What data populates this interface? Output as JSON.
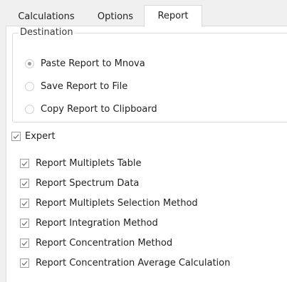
{
  "tabs": [
    {
      "label": "Calculations",
      "active": false
    },
    {
      "label": "Options",
      "active": false
    },
    {
      "label": "Report",
      "active": true
    }
  ],
  "destination": {
    "title": "Destination",
    "options": [
      {
        "label": "Paste Report to Mnova",
        "selected": true
      },
      {
        "label": "Save Report to File",
        "selected": false
      },
      {
        "label": "Copy Report to Clipboard",
        "selected": false
      }
    ]
  },
  "expert": {
    "label": "Expert",
    "checked": true
  },
  "report_options": [
    {
      "label": "Report Multiplets Table",
      "checked": true
    },
    {
      "label": "Report Spectrum Data",
      "checked": true
    },
    {
      "label": "Report Multiplets Selection Method",
      "checked": true
    },
    {
      "label": "Report Integration Method",
      "checked": true
    },
    {
      "label": "Report Concentration Method",
      "checked": true
    },
    {
      "label": "Report Concentration Average Calculation",
      "checked": true
    }
  ],
  "colors": {
    "window_bg": "#f0f0f0",
    "pane_bg": "#ffffff",
    "border": "#d9d9d9",
    "check_mark": "#6e6e6e",
    "radio_dot": "#9a9a9a"
  }
}
